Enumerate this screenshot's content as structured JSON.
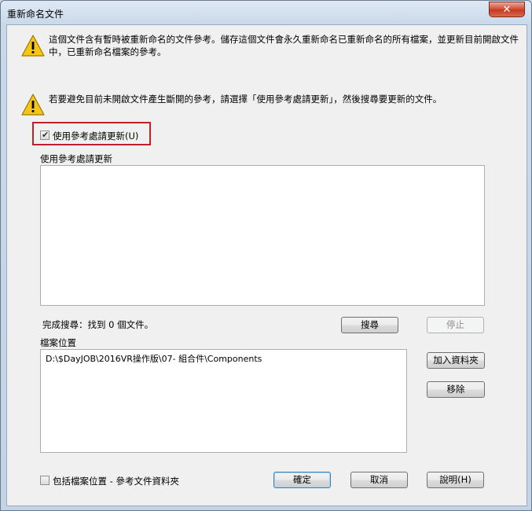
{
  "window": {
    "title": "重新命名文件",
    "close_glyph": "✕"
  },
  "messages": {
    "warning1": "這個文件含有暫時被重新命名的文件參考。儲存這個文件會永久重新命名已重新命名的所有檔案，並更新目前開啟文件中，已重新命名檔案的參考。",
    "warning2": "若要避免目前未開啟文件產生斷開的參考，請選擇「使用參考處請更新」，然後搜尋要更新的文件。"
  },
  "use_reference": {
    "checkbox_label": "使用參考處請更新(U)",
    "checked": true,
    "list_label": "使用參考處請更新"
  },
  "search": {
    "status_text": "完成搜尋：找到 0 個文件。",
    "search_button": "搜尋",
    "stop_button": "停止"
  },
  "file_location": {
    "label": "檔案位置",
    "paths": [
      "D:\\$DayJOB\\2016VR操作版\\07- 組合件\\Components"
    ],
    "add_folder_button": "加入資料夾",
    "remove_button": "移除"
  },
  "footer": {
    "include_label": "包括檔案位置 - 參考文件資料夾",
    "include_checked": false,
    "ok_button": "確定",
    "cancel_button": "取消",
    "help_button": "說明(H)"
  }
}
